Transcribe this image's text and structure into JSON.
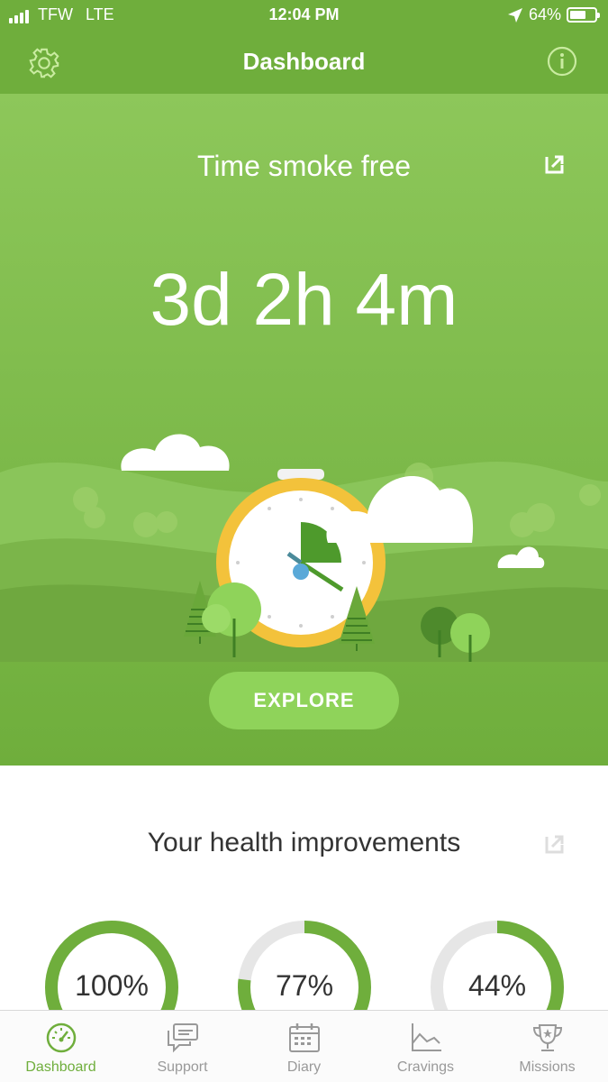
{
  "status_bar": {
    "carrier": "TFW",
    "network": "LTE",
    "time": "12:04 PM",
    "battery": "64%",
    "battery_level": 0.64
  },
  "nav": {
    "title": "Dashboard",
    "left_icon": "gear-icon",
    "right_icon": "info-icon"
  },
  "hero": {
    "label": "Time smoke free",
    "time": "3d 2h 4m",
    "explore_label": "EXPLORE",
    "share_icon": "share-icon"
  },
  "health": {
    "title": "Your health improvements",
    "rings": [
      {
        "value": "100%",
        "fraction": 1.0
      },
      {
        "value": "77%",
        "fraction": 0.77
      },
      {
        "value": "44%",
        "fraction": 0.44
      }
    ]
  },
  "tabs": [
    {
      "label": "Dashboard",
      "icon": "speedometer-icon",
      "active": true
    },
    {
      "label": "Support",
      "icon": "chat-icon",
      "active": false
    },
    {
      "label": "Diary",
      "icon": "calendar-icon",
      "active": false
    },
    {
      "label": "Cravings",
      "icon": "chart-icon",
      "active": false
    },
    {
      "label": "Missions",
      "icon": "trophy-icon",
      "active": false
    }
  ],
  "colors": {
    "brand_green": "#6fae3c",
    "light_green": "#8fd35a",
    "clock_yellow": "#f3c23b",
    "ring_track": "#e6e6e6",
    "tab_inactive": "#999999"
  }
}
